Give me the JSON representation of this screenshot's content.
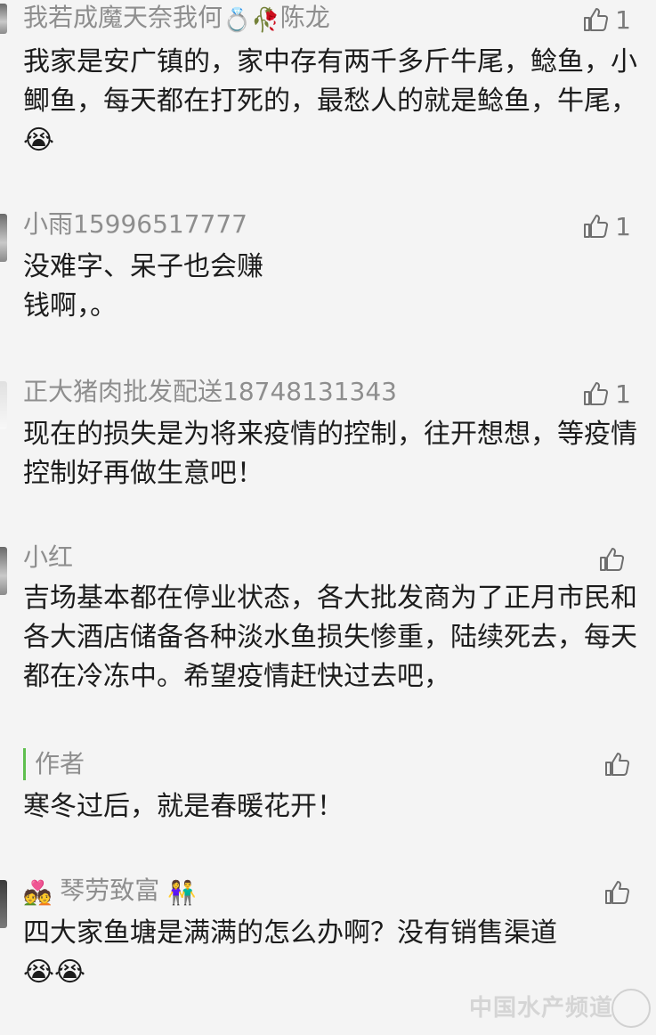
{
  "comments": [
    {
      "name": "我若成魔天奈我何",
      "name_suffix": "陈龙",
      "name_emoji": "💍🥀",
      "likes": "1",
      "text": "我家是安广镇的，家中存有两千多斤牛尾，鲶鱼，小鲫鱼，每天都在打死的，最愁人的就是鲶鱼，牛尾，",
      "text_emoji": "😭"
    },
    {
      "name": "小雨15996517777",
      "likes": "1",
      "text_line1": "没难字、呆子也会赚",
      "text_line2": "钱啊，。"
    },
    {
      "name": "正大猪肉批发配送18748131343",
      "likes": "1",
      "text": "现在的损失是为将来疫情的控制，往开想想，等疫情控制好再做生意吧！"
    },
    {
      "name": "小红",
      "likes": "",
      "text": "吉场基本都在停业状态，各大批发商为了正月市民和各大酒店储备各种淡水鱼损失惨重，陆续死去，每天都在冷冻中。希望疫情赶快过去吧，",
      "reply": {
        "label": "作者",
        "text": "寒冬过后，就是春暖花开！"
      }
    },
    {
      "name": "琴劳致富",
      "name_prefix_emoji": "💑",
      "name_suffix_emoji": "👫",
      "likes": "",
      "text": "四大家鱼塘是满满的怎么办啊？没有销售渠道",
      "text_emoji": "😭😭"
    }
  ],
  "watermark": "中国水产频道",
  "icons": {
    "like": "thumbs-up-icon"
  },
  "colors": {
    "accent": "#5fbf4f",
    "muted": "#8e8e8e"
  }
}
